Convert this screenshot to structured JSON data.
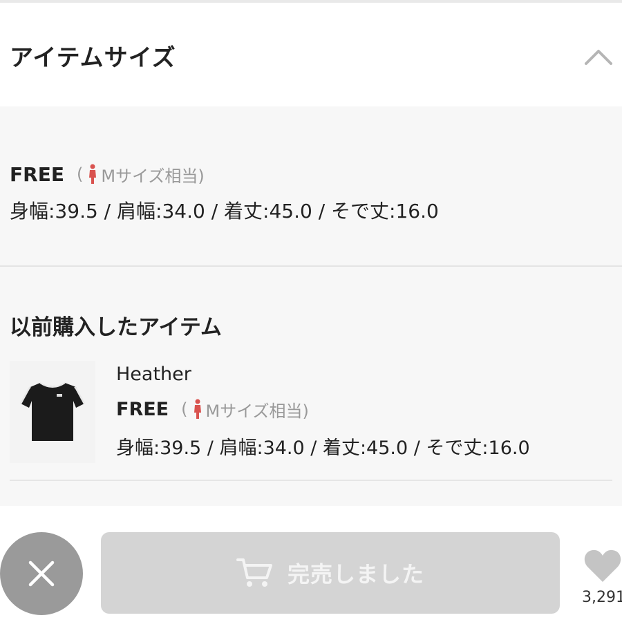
{
  "header": {
    "title": "アイテムサイズ",
    "collapse_icon": "chevron-up-icon"
  },
  "size": {
    "name": "FREE",
    "equiv_open": "(",
    "equiv_text": "Mサイズ相当)",
    "person_icon": "person-icon",
    "person_color": "#d9534f",
    "measurements": "身幅:39.5 / 肩幅:34.0 / 着丈:45.0 / そで丈:16.0"
  },
  "previous": {
    "title": "以前購入したアイテム",
    "item": {
      "brand": "Heather",
      "size_name": "FREE",
      "equiv_open": "(",
      "equiv_text": "Mサイズ相当)",
      "measurements": "身幅:39.5 / 肩幅:34.0 / 着丈:45.0 / そで丈:16.0"
    }
  },
  "footer": {
    "close_icon": "close-icon",
    "soldout_label": "完売しました",
    "cart_icon": "cart-icon",
    "heart_icon": "heart-icon",
    "favorite_count": "3,291"
  }
}
